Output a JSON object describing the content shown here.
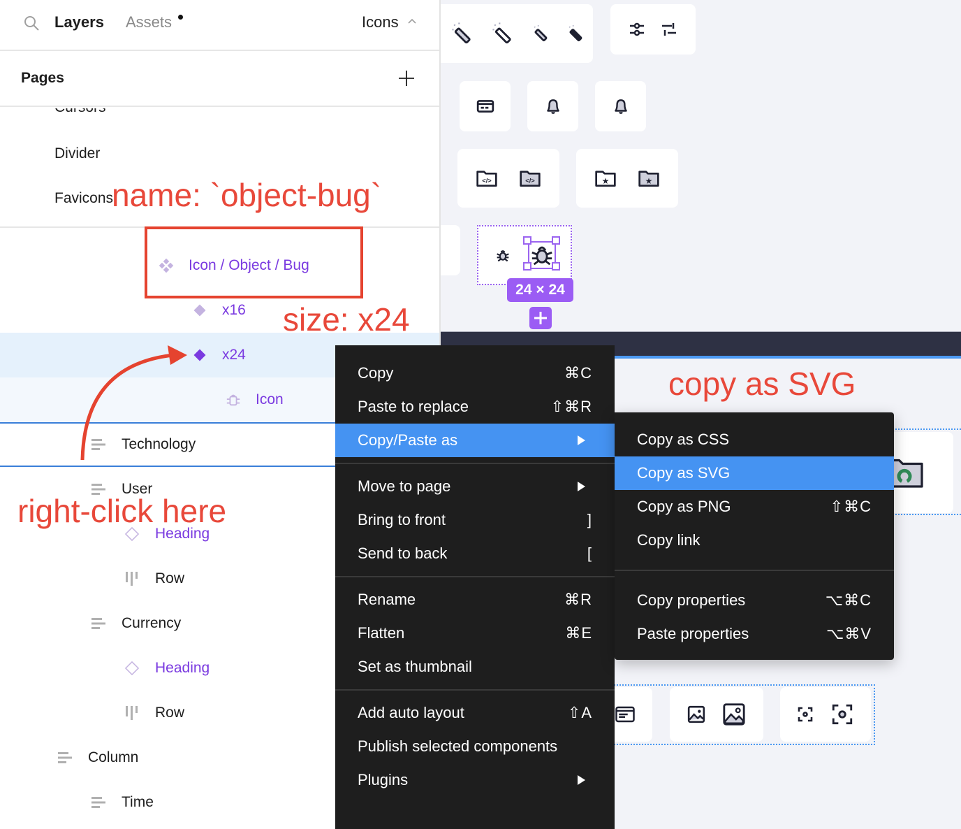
{
  "panel": {
    "tabs": {
      "layers": "Layers",
      "assets": "Assets",
      "page_selector": "Icons"
    },
    "pages_title": "Pages",
    "pages": [
      "Cursors",
      "Divider",
      "Favicons"
    ],
    "layers": [
      {
        "label": "Icon / Object / Bug",
        "kind": "component-set"
      },
      {
        "label": "x16",
        "kind": "variant"
      },
      {
        "label": "x24",
        "kind": "variant",
        "selected": true
      },
      {
        "label": "Icon",
        "kind": "instance"
      },
      {
        "label": "Technology",
        "kind": "frame"
      },
      {
        "label": "User",
        "kind": "frame"
      },
      {
        "label": "Heading",
        "kind": "component-instance"
      },
      {
        "label": "Row",
        "kind": "row"
      },
      {
        "label": "Currency",
        "kind": "frame"
      },
      {
        "label": "Heading",
        "kind": "component-instance"
      },
      {
        "label": "Row",
        "kind": "row"
      },
      {
        "label": "Column",
        "kind": "frame"
      },
      {
        "label": "Time",
        "kind": "frame"
      }
    ]
  },
  "canvas": {
    "selection_size": "24 × 24"
  },
  "annotations": {
    "name": "name: `object-bug`",
    "size": "size: x24",
    "right_click": "right-click here",
    "copy_svg": "copy as SVG"
  },
  "context_menu": {
    "groups": [
      [
        {
          "label": "Copy",
          "shortcut": "⌘C"
        },
        {
          "label": "Paste to replace",
          "shortcut": "⇧⌘R"
        },
        {
          "label": "Copy/Paste as",
          "submenu": true,
          "active": true
        }
      ],
      [
        {
          "label": "Move to page",
          "submenu": true
        },
        {
          "label": "Bring to front",
          "shortcut": "]"
        },
        {
          "label": "Send to back",
          "shortcut": "["
        }
      ],
      [
        {
          "label": "Rename",
          "shortcut": "⌘R"
        },
        {
          "label": "Flatten",
          "shortcut": "⌘E"
        },
        {
          "label": "Set as thumbnail"
        }
      ],
      [
        {
          "label": "Add auto layout",
          "shortcut": "⇧A"
        },
        {
          "label": "Publish selected components"
        },
        {
          "label": "Plugins",
          "submenu": true
        }
      ]
    ]
  },
  "submenu": {
    "groups": [
      [
        {
          "label": "Copy as CSS"
        },
        {
          "label": "Copy as SVG",
          "active": true
        },
        {
          "label": "Copy as PNG",
          "shortcut": "⇧⌘C"
        },
        {
          "label": "Copy link"
        }
      ],
      [
        {
          "label": "Copy properties",
          "shortcut": "⌥⌘C"
        },
        {
          "label": "Paste properties",
          "shortcut": "⌥⌘V"
        }
      ]
    ]
  },
  "colors": {
    "accent_purple": "#9b5cf4",
    "menu_highlight": "#4593f2",
    "annotation_red": "#e8483a",
    "menu_bg": "#1e1e1e"
  }
}
